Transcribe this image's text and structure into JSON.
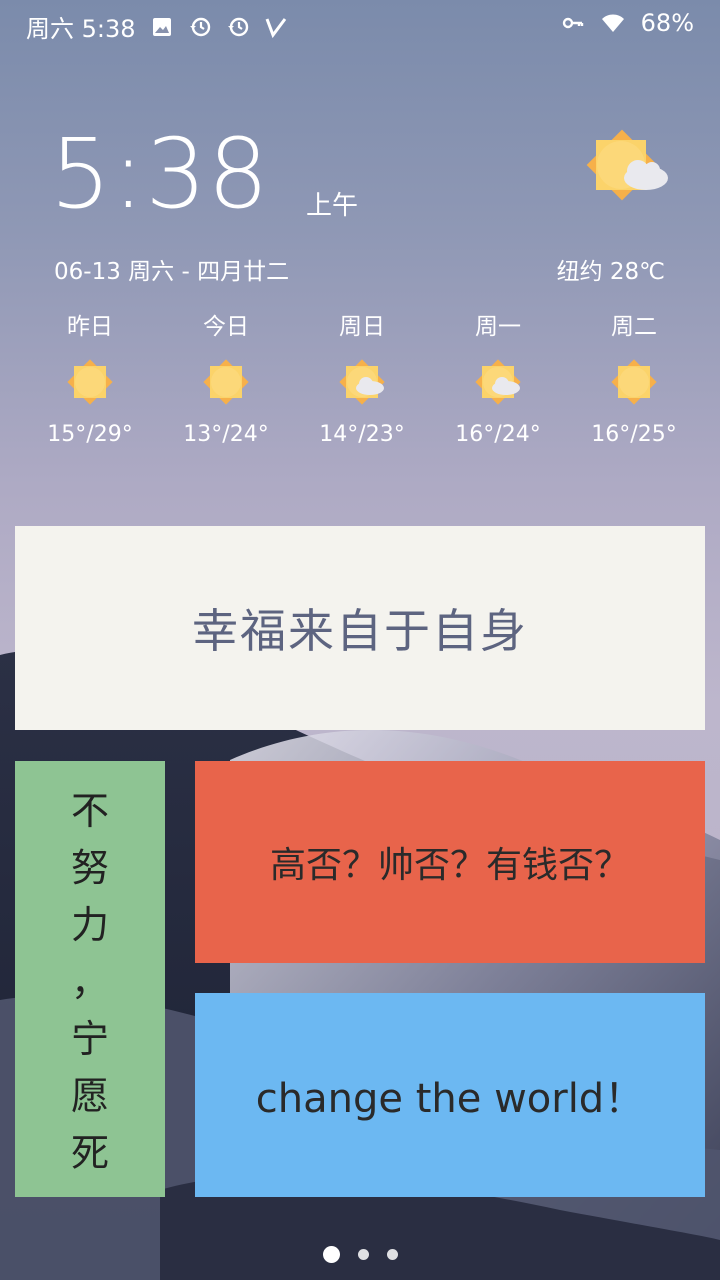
{
  "status_bar": {
    "day_time": "周六 5:38",
    "battery": "68%",
    "left_icons": [
      "image-icon",
      "history-icon",
      "history-icon",
      "v-app-icon"
    ],
    "right_icons": [
      "key-icon",
      "wifi-icon"
    ]
  },
  "clock": {
    "time": "5:38",
    "ampm": "上午"
  },
  "date_line": "06-13 周六 - 四月廿二",
  "weather": {
    "city_temp": "纽约 28℃",
    "icon": "sun-cloud-icon"
  },
  "forecast": [
    {
      "day": "昨日",
      "temp": "15°/29°",
      "icon": "sun-icon"
    },
    {
      "day": "今日",
      "temp": "13°/24°",
      "icon": "sun-icon"
    },
    {
      "day": "周日",
      "temp": "14°/23°",
      "icon": "sun-cloud-icon"
    },
    {
      "day": "周一",
      "temp": "16°/24°",
      "icon": "sun-cloud-icon"
    },
    {
      "day": "周二",
      "temp": "16°/25°",
      "icon": "sun-icon"
    }
  ],
  "cards": {
    "happy": "幸福来自于自身",
    "vertical": [
      "不",
      "努",
      "力",
      "，",
      "宁",
      "愿",
      "死"
    ],
    "red": "高否？帅否？有钱否？",
    "blue": "change the world！"
  },
  "colors": {
    "card_white": "#f4f3ee",
    "card_green": "#8ec493",
    "card_red": "#e8644b",
    "card_blue": "#6cb8f2",
    "sun": "#fbd36a"
  },
  "pager": {
    "count": 3,
    "active": 0
  }
}
